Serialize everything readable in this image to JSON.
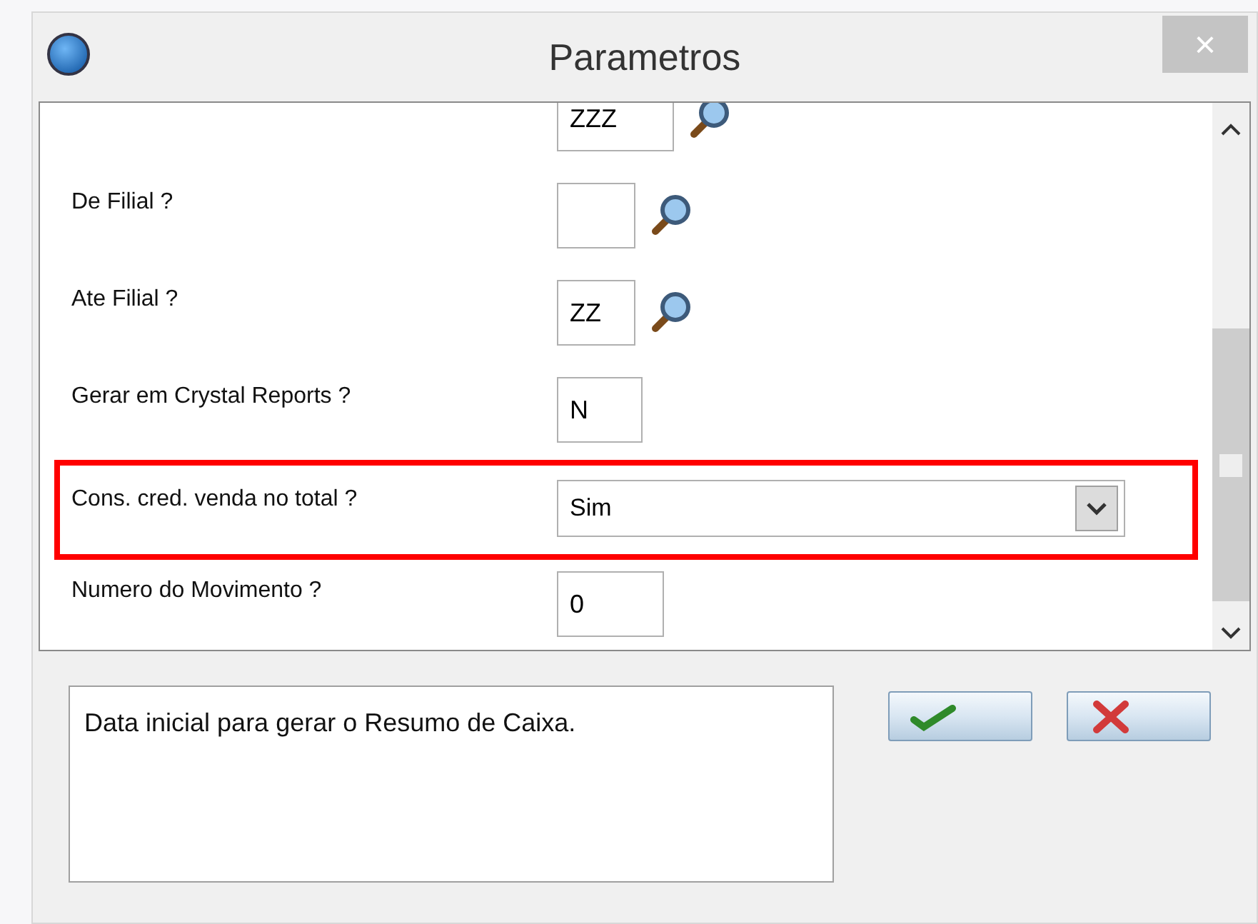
{
  "window": {
    "title": "Parametros",
    "close": "×"
  },
  "params": [
    {
      "kind": "lookup",
      "value": "ZZZ",
      "highlighted": false
    },
    {
      "label": "De Filial ?",
      "kind": "lookup",
      "highlighted": false
    },
    {
      "label": "Ate Filial ?",
      "kind": "lookup",
      "value": "ZZ",
      "highlighted": false
    },
    {
      "label": "Gerar em Crystal Reports ?",
      "kind": "text",
      "value": "N",
      "highlighted": false
    },
    {
      "label": "Cons. cred. venda no total ?",
      "kind": "select",
      "value": "Sim",
      "highlighted": true
    },
    {
      "label": "Numero do Movimento ?",
      "kind": "text",
      "value": "0",
      "highlighted": false
    }
  ],
  "description": "Data inicial para gerar o Resumo de Caixa."
}
